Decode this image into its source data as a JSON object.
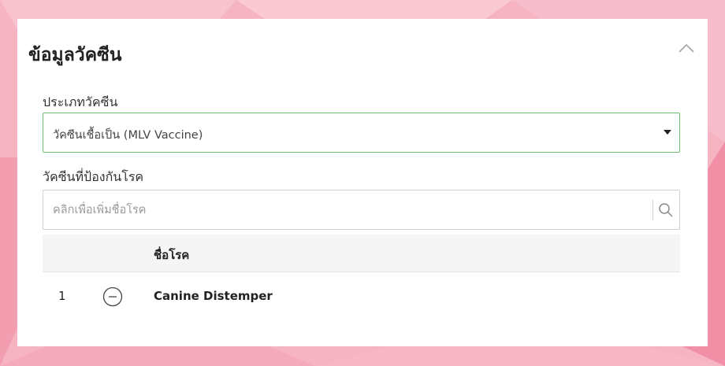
{
  "panel": {
    "title": "ข้อมูลวัคซีน"
  },
  "vaccine_type": {
    "label": "ประเภทวัคซีน",
    "selected": "วัคซีนเชื้อเป็น (MLV Vaccine)"
  },
  "diseases": {
    "label": "วัคซีนที่ป้องกันโรค",
    "placeholder": "คลิกเพื่อเพิ่มชื่อโรค",
    "column_name": "ชื่อโรค",
    "rows": [
      {
        "index": "1",
        "name": "Canine Distemper"
      }
    ]
  },
  "colors": {
    "select_border": "#6fbf73",
    "background": "#f4a8b8"
  },
  "icons": {
    "collapse": "chevron-up-icon",
    "dropdown": "caret-down-icon",
    "search": "search-icon",
    "remove": "minus-circle-icon"
  }
}
